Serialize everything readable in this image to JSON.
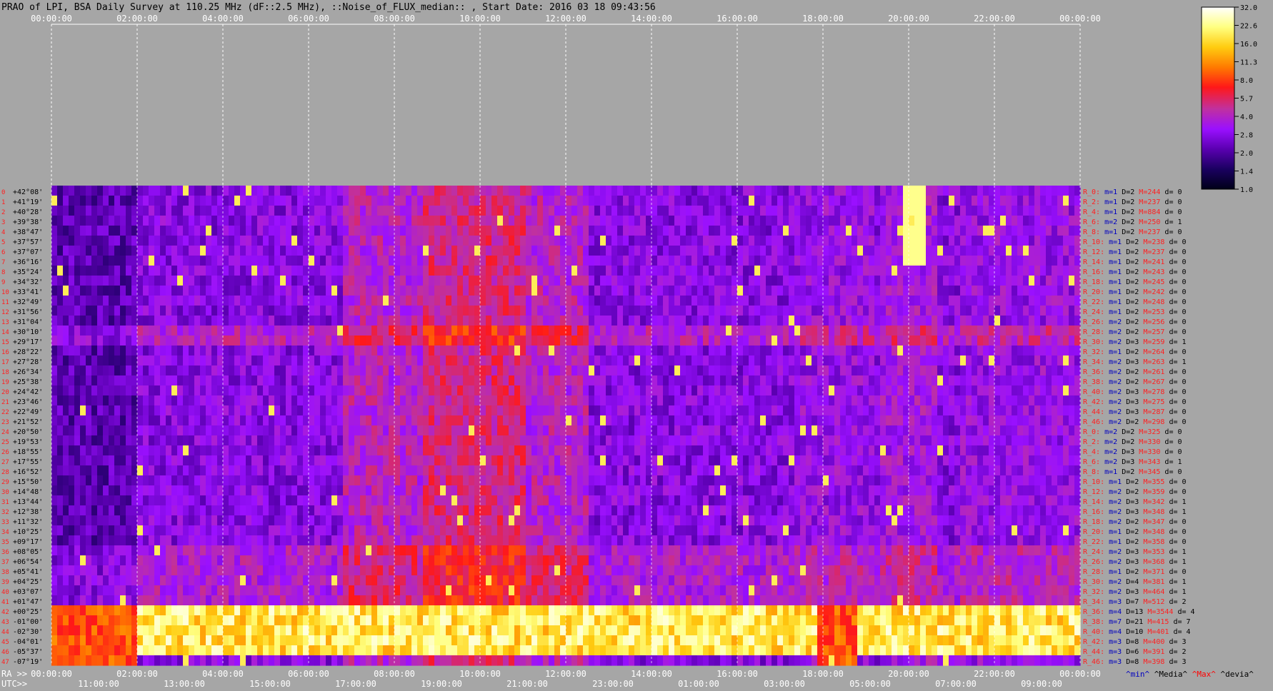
{
  "chart_data": {
    "type": "heatmap",
    "title": "PRAO of LPI, BSA Daily Survey at 110.25 MHz (dF::2.5 MHz), ::Noise_of_FLUX_median:: , Start Date: 2016 03 18 09:43:56",
    "x_top_ticks": [
      "00:00:00",
      "02:00:00",
      "04:00:00",
      "06:00:00",
      "08:00:00",
      "10:00:00",
      "12:00:00",
      "14:00:00",
      "16:00:00",
      "18:00:00",
      "20:00:00",
      "22:00:00",
      "00:00:00"
    ],
    "x_bottom_ra_label": "RA >>",
    "x_bottom_ra_ticks": [
      "00:00:00",
      "02:00:00",
      "04:00:00",
      "06:00:00",
      "08:00:00",
      "10:00:00",
      "12:00:00",
      "14:00:00",
      "16:00:00",
      "18:00:00",
      "20:00:00",
      "22:00:00",
      "00:00:00"
    ],
    "x_bottom_utc_label": "UTC>>",
    "x_bottom_utc_ticks": [
      "11:00:00",
      "13:00:00",
      "15:00:00",
      "17:00:00",
      "19:00:00",
      "21:00:00",
      "23:00:00",
      "01:00:00",
      "03:00:00",
      "05:00:00",
      "07:00:00",
      "09:00:00"
    ],
    "declinations": [
      "+42°08'",
      "+41°19'",
      "+40°28'",
      "+39°38'",
      "+38°47'",
      "+37°57'",
      "+37°07'",
      "+36°16'",
      "+35°24'",
      "+34°32'",
      "+33°41'",
      "+32°49'",
      "+31°56'",
      "+31°04'",
      "+30°10'",
      "+29°17'",
      "+28°22'",
      "+27°28'",
      "+26°34'",
      "+25°38'",
      "+24°42'",
      "+23°46'",
      "+22°49'",
      "+21°52'",
      "+20°50'",
      "+19°53'",
      "+18°55'",
      "+17°55'",
      "+16°52'",
      "+15°50'",
      "+14°48'",
      "+13°44'",
      "+12°38'",
      "+11°32'",
      "+10°25'",
      "+09°17'",
      "+08°05'",
      "+06°54'",
      "+05°41'",
      "+04°25'",
      "+03°07'",
      "+01°47'",
      "+00°25'",
      "-01°00'",
      "-02°30'",
      "-04°01'",
      "-05°37'",
      "-07°19'"
    ],
    "beam_numbers": [
      "0",
      "1",
      "2",
      "3",
      "4",
      "5",
      "6",
      "7",
      "8",
      "9",
      "10",
      "11",
      "12",
      "13",
      "14",
      "15",
      "16",
      "17",
      "18",
      "19",
      "20",
      "21",
      "22",
      "23",
      "24",
      "25",
      "26",
      "27",
      "28",
      "29",
      "30",
      "31",
      "32",
      "33",
      "34",
      "35",
      "36",
      "37",
      "38",
      "39",
      "40",
      "41",
      "42",
      "43",
      "44",
      "45",
      "46",
      "47"
    ],
    "colorbar": {
      "ticks": [
        "32.0",
        "22.6",
        "16.0",
        "11.3",
        "8.0",
        "5.7",
        "4.0",
        "2.8",
        "2.0",
        "1.4",
        "1.0"
      ],
      "colors": [
        "#000018",
        "#1a0060",
        "#5a00b0",
        "#9a10ff",
        "#c030a0",
        "#ff1818",
        "#ff7a00",
        "#ffcc10",
        "#ffff80",
        "#ffffff"
      ]
    },
    "stats": [
      {
        "r": "R_0:",
        "m": "m=1",
        "d": "D=2",
        "M": "M=244",
        "dv": "d= 0"
      },
      {
        "r": "R_2:",
        "m": "m=1",
        "d": "D=2",
        "M": "M=237",
        "dv": "d= 0"
      },
      {
        "r": "R_4:",
        "m": "m=1",
        "d": "D=2",
        "M": "M=884",
        "dv": "d= 0"
      },
      {
        "r": "R_6:",
        "m": "m=2",
        "d": "D=2",
        "M": "M=250",
        "dv": "d= 1"
      },
      {
        "r": "R_8:",
        "m": "m=1",
        "d": "D=2",
        "M": "M=237",
        "dv": "d= 0"
      },
      {
        "r": "R_10:",
        "m": "m=1",
        "d": "D=2",
        "M": "M=238",
        "dv": "d= 0"
      },
      {
        "r": "R_12:",
        "m": "m=1",
        "d": "D=2",
        "M": "M=237",
        "dv": "d= 0"
      },
      {
        "r": "R_14:",
        "m": "m=1",
        "d": "D=2",
        "M": "M=241",
        "dv": "d= 0"
      },
      {
        "r": "R_16:",
        "m": "m=1",
        "d": "D=2",
        "M": "M=243",
        "dv": "d= 0"
      },
      {
        "r": "R_18:",
        "m": "m=1",
        "d": "D=2",
        "M": "M=245",
        "dv": "d= 0"
      },
      {
        "r": "R_20:",
        "m": "m=1",
        "d": "D=2",
        "M": "M=242",
        "dv": "d= 0"
      },
      {
        "r": "R_22:",
        "m": "m=1",
        "d": "D=2",
        "M": "M=248",
        "dv": "d= 0"
      },
      {
        "r": "R_24:",
        "m": "m=1",
        "d": "D=2",
        "M": "M=253",
        "dv": "d= 0"
      },
      {
        "r": "R_26:",
        "m": "m=2",
        "d": "D=2",
        "M": "M=256",
        "dv": "d= 0"
      },
      {
        "r": "R_28:",
        "m": "m=2",
        "d": "D=2",
        "M": "M=257",
        "dv": "d= 0"
      },
      {
        "r": "R_30:",
        "m": "m=2",
        "d": "D=3",
        "M": "M=259",
        "dv": "d= 1"
      },
      {
        "r": "R_32:",
        "m": "m=1",
        "d": "D=2",
        "M": "M=264",
        "dv": "d= 0"
      },
      {
        "r": "R_34:",
        "m": "m=2",
        "d": "D=3",
        "M": "M=263",
        "dv": "d= 1"
      },
      {
        "r": "R_36:",
        "m": "m=2",
        "d": "D=2",
        "M": "M=261",
        "dv": "d= 0"
      },
      {
        "r": "R_38:",
        "m": "m=2",
        "d": "D=2",
        "M": "M=267",
        "dv": "d= 0"
      },
      {
        "r": "R_40:",
        "m": "m=2",
        "d": "D=3",
        "M": "M=278",
        "dv": "d= 0"
      },
      {
        "r": "R_42:",
        "m": "m=2",
        "d": "D=3",
        "M": "M=275",
        "dv": "d= 0"
      },
      {
        "r": "R_44:",
        "m": "m=2",
        "d": "D=3",
        "M": "M=287",
        "dv": "d= 0"
      },
      {
        "r": "R_46:",
        "m": "m=2",
        "d": "D=2",
        "M": "M=298",
        "dv": "d= 0"
      },
      {
        "r": "R_0:",
        "m": "m=2",
        "d": "D=2",
        "M": "M=325",
        "dv": "d= 0"
      },
      {
        "r": "R_2:",
        "m": "m=2",
        "d": "D=2",
        "M": "M=330",
        "dv": "d= 0"
      },
      {
        "r": "R_4:",
        "m": "m=2",
        "d": "D=3",
        "M": "M=330",
        "dv": "d= 0"
      },
      {
        "r": "R_6:",
        "m": "m=2",
        "d": "D=3",
        "M": "M=343",
        "dv": "d= 1"
      },
      {
        "r": "R_8:",
        "m": "m=1",
        "d": "D=2",
        "M": "M=345",
        "dv": "d= 0"
      },
      {
        "r": "R_10:",
        "m": "m=1",
        "d": "D=2",
        "M": "M=355",
        "dv": "d= 0"
      },
      {
        "r": "R_12:",
        "m": "m=2",
        "d": "D=2",
        "M": "M=359",
        "dv": "d= 0"
      },
      {
        "r": "R_14:",
        "m": "m=2",
        "d": "D=3",
        "M": "M=342",
        "dv": "d= 1"
      },
      {
        "r": "R_16:",
        "m": "m=2",
        "d": "D=3",
        "M": "M=348",
        "dv": "d= 1"
      },
      {
        "r": "R_18:",
        "m": "m=2",
        "d": "D=2",
        "M": "M=347",
        "dv": "d= 0"
      },
      {
        "r": "R_20:",
        "m": "m=1",
        "d": "D=2",
        "M": "M=348",
        "dv": "d= 0"
      },
      {
        "r": "R_22:",
        "m": "m=1",
        "d": "D=2",
        "M": "M=358",
        "dv": "d= 0"
      },
      {
        "r": "R_24:",
        "m": "m=2",
        "d": "D=3",
        "M": "M=353",
        "dv": "d= 1"
      },
      {
        "r": "R_26:",
        "m": "m=2",
        "d": "D=3",
        "M": "M=368",
        "dv": "d= 1"
      },
      {
        "r": "R_28:",
        "m": "m=1",
        "d": "D=2",
        "M": "M=371",
        "dv": "d= 0"
      },
      {
        "r": "R_30:",
        "m": "m=2",
        "d": "D=4",
        "M": "M=381",
        "dv": "d= 1"
      },
      {
        "r": "R_32:",
        "m": "m=2",
        "d": "D=3",
        "M": "M=464",
        "dv": "d= 1"
      },
      {
        "r": "R_34:",
        "m": "m=3",
        "d": "D=7",
        "M": "M=512",
        "dv": "d= 2"
      },
      {
        "r": "R_36:",
        "m": "m=4",
        "d": "D=13",
        "M": "M=3544",
        "dv": "d= 4"
      },
      {
        "r": "R_38:",
        "m": "m=7",
        "d": "D=21",
        "M": "M=415",
        "dv": "d= 7"
      },
      {
        "r": "R_40:",
        "m": "m=4",
        "d": "D=10",
        "M": "M=401",
        "dv": "d= 4"
      },
      {
        "r": "R_42:",
        "m": "m=3",
        "d": "D=8",
        "M": "M=400",
        "dv": "d= 3"
      },
      {
        "r": "R_44:",
        "m": "m=3",
        "d": "D=6",
        "M": "M=391",
        "dv": "d= 2"
      },
      {
        "r": "R_46:",
        "m": "m=3",
        "d": "D=8",
        "M": "M=398",
        "dv": "d= 3"
      }
    ],
    "stats_legend": [
      {
        "text": "^min^",
        "color": "#0000c0"
      },
      {
        "text": "^Media^",
        "color": "#000000"
      },
      {
        "text": "^Max^",
        "color": "#ff0000"
      },
      {
        "text": "^devia^",
        "color": "#000000"
      }
    ],
    "grid": true
  }
}
